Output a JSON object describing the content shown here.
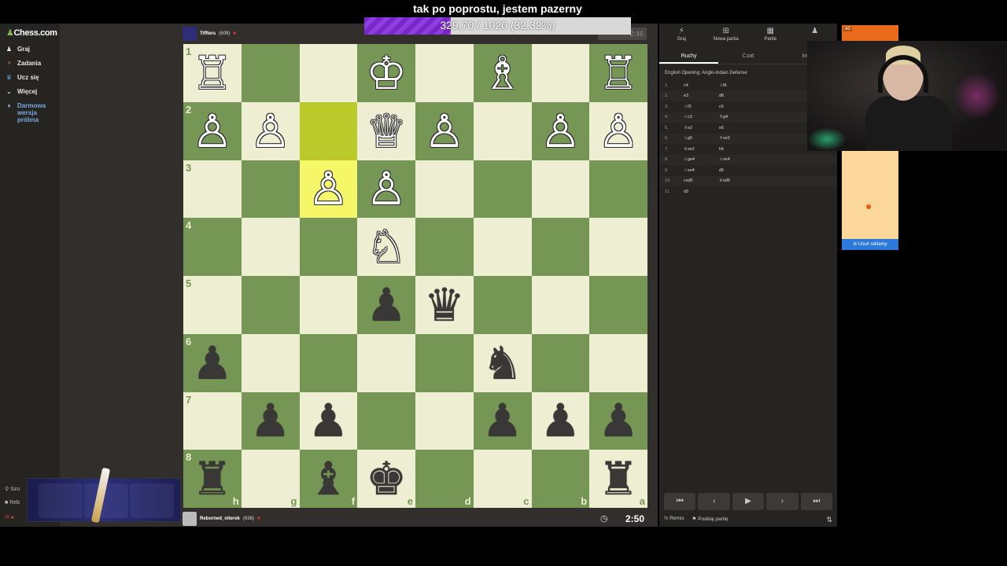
{
  "overlay": {
    "caption": "tak po poprostu, jestem pazerny",
    "progress_text": "329,70 / 1020 (32,32%)",
    "progress_fraction": 0.3232
  },
  "sidebar": {
    "logo": "Chess.com",
    "items": [
      {
        "label": "Graj",
        "icon": "♟"
      },
      {
        "label": "Zadania",
        "icon": "⚡"
      },
      {
        "label": "Ucz się",
        "icon": "♛"
      },
      {
        "label": "Więcej",
        "icon": "⌄"
      }
    ],
    "premium_lines": [
      "Darmowa",
      "wersja",
      "próbna"
    ],
    "search": "Szu",
    "user": "Reb"
  },
  "opponent": {
    "name": "Tiffters",
    "rating": "(609)"
  },
  "player": {
    "name": "Reborned_niterek",
    "rating": "(636)",
    "clock": "2:50"
  },
  "opponent_clock": "2:46",
  "board": {
    "ranks": [
      "1",
      "2",
      "3",
      "4",
      "5",
      "6",
      "7",
      "8"
    ],
    "files": [
      "h",
      "g",
      "f",
      "e",
      "d",
      "c",
      "b",
      "a"
    ],
    "highlight": [
      [
        1,
        2
      ],
      [
        2,
        2
      ]
    ],
    "pieces": [
      [
        "♖",
        "",
        "",
        "♔",
        "",
        "♗",
        "",
        "♖"
      ],
      [
        "♙",
        "♙",
        "",
        "♕",
        "♙",
        "",
        "♙",
        "♙"
      ],
      [
        "",
        "",
        "♙",
        "♙",
        "",
        "",
        "",
        ""
      ],
      [
        "",
        "",
        "",
        "♘",
        "",
        "",
        "",
        ""
      ],
      [
        "",
        "",
        "",
        "♟",
        "♛",
        "",
        "",
        ""
      ],
      [
        "♟",
        "",
        "",
        "",
        "",
        "♞",
        "",
        ""
      ],
      [
        "",
        "♟",
        "♟",
        "",
        "",
        "♟",
        "♟",
        "♟"
      ],
      [
        "♜",
        "",
        "♝",
        "♚",
        "",
        "",
        "",
        "♜"
      ]
    ]
  },
  "panel": {
    "top_tabs": [
      {
        "icon": "⚡",
        "label": "Graj"
      },
      {
        "icon": "⊞",
        "label": "Nowa partia"
      },
      {
        "icon": "▦",
        "label": "Partie"
      },
      {
        "icon": "♟",
        "label": ""
      }
    ],
    "tabs": [
      "Ruchy",
      "Czat",
      "Infor"
    ],
    "opening": "English Opening: Anglo-Indian Defense",
    "moves": [
      {
        "n": "1.",
        "w": "c4",
        "b": "♘f6"
      },
      {
        "n": "2.",
        "w": "e3",
        "b": "d6"
      },
      {
        "n": "3.",
        "w": "♘f3",
        "b": "c6"
      },
      {
        "n": "4.",
        "w": "♘c3",
        "b": "♗g4"
      },
      {
        "n": "5.",
        "w": "♗e2",
        "b": "e5"
      },
      {
        "n": "6.",
        "w": "♘g5",
        "b": "♗xe2"
      },
      {
        "n": "7.",
        "w": "♕xe2",
        "b": "h6"
      },
      {
        "n": "8.",
        "w": "♘ge4",
        "b": "♘xe4"
      },
      {
        "n": "9.",
        "w": "♘xe4",
        "b": "d5"
      },
      {
        "n": "10.",
        "w": "cxd5",
        "b": "♕xd5"
      },
      {
        "n": "11.",
        "w": "d3",
        "b": ""
      }
    ],
    "controls": [
      "⏮",
      "‹",
      "▶",
      "›",
      "⏭"
    ],
    "draw": "Remis",
    "resign": "Poddaj partię"
  },
  "ad": {
    "tag": "AD",
    "remove": "Usuń reklamy"
  }
}
